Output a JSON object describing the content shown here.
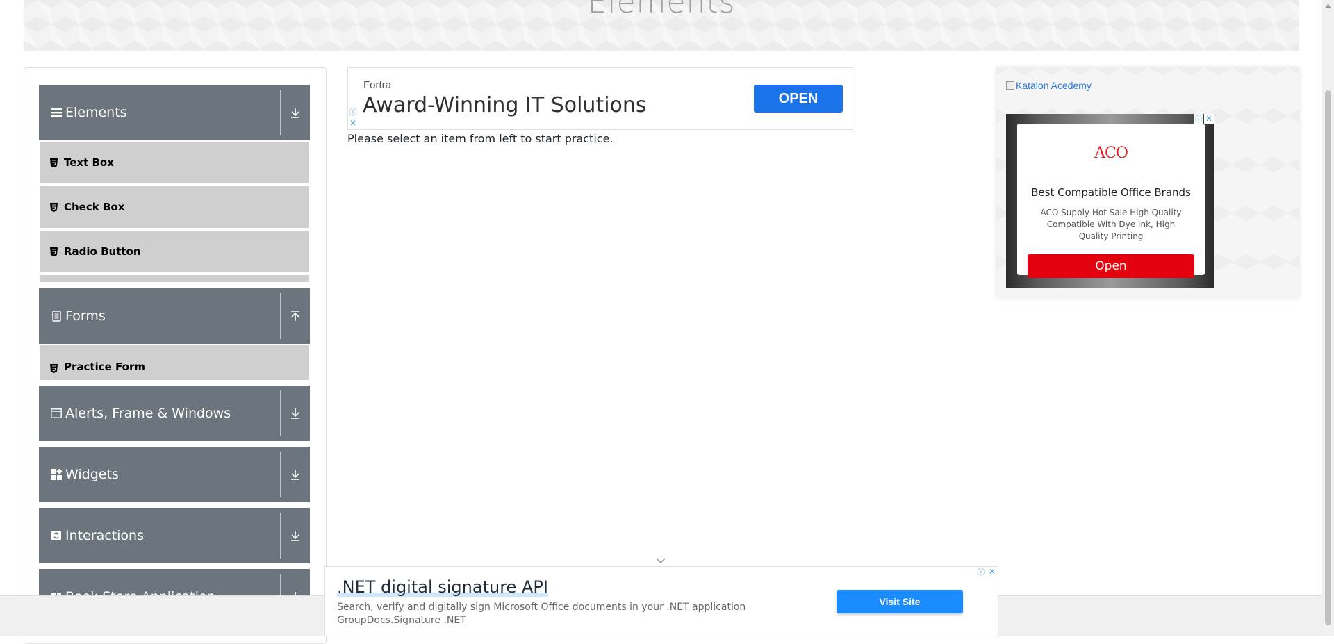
{
  "header": {
    "title": "Elements"
  },
  "sidebar": {
    "groups": [
      {
        "label": "Elements",
        "icon": "hamburger-icon",
        "arrow": "download-arrow-icon"
      },
      {
        "label": "Forms",
        "icon": "document-icon",
        "arrow": "upload-arrow-icon"
      },
      {
        "label": "Alerts, Frame & Windows",
        "icon": "window-icon",
        "arrow": "download-arrow-icon"
      },
      {
        "label": "Widgets",
        "icon": "widgets-icon",
        "arrow": "download-arrow-icon"
      },
      {
        "label": "Interactions",
        "icon": "interactions-icon",
        "arrow": "download-arrow-icon"
      },
      {
        "label": "Book Store Application",
        "icon": "book-icon",
        "arrow": "download-arrow-icon"
      }
    ],
    "elements_items": [
      "Text Box",
      "Check Box",
      "Radio Button"
    ],
    "forms_items": [
      "Practice Form"
    ]
  },
  "top_ad": {
    "brand": "Fortra",
    "headline": "Award-Winning IT Solutions",
    "button": "OPEN"
  },
  "instructions": "Please select an item from left to start practice.",
  "right_ad": {
    "link_text": "Katalon Acedemy",
    "logo": "ACO",
    "title": "Best Compatible Office Brands",
    "description": "ACO Supply Hot Sale High Quality Compatible With Dye Ink, High Quality Printing",
    "button": "Open"
  },
  "bottom_ad": {
    "headline": ".NET digital signature API",
    "description_line1": "Search, verify and digitally sign Microsoft Office documents in your .NET application",
    "description_line2": "GroupDocs.Signature .NET",
    "button": "Visit Site"
  },
  "colors": {
    "sidebar_header": "#6c757d",
    "menu_item": "#cfcfcf",
    "primary_blue": "#1a73e8",
    "aco_red": "#e3000f"
  }
}
